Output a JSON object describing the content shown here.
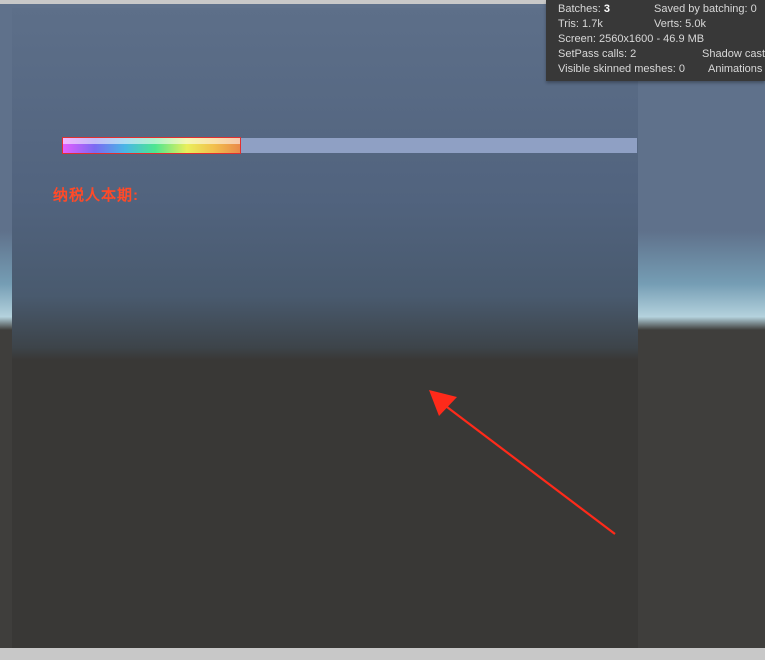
{
  "stats": {
    "batches_label": "Batches:",
    "batches_value": "3",
    "saved_label": "Saved by batching: 0",
    "tris_label": "Tris: 1.7k",
    "verts_label": "Verts: 5.0k",
    "screen_label": "Screen: 2560x1600 - 46.9 MB",
    "setpass_label": "SetPass calls: 2",
    "shadow_label": "Shadow cast",
    "meshes_label": "Visible skinned meshes: 0",
    "anim_label": "Animations"
  },
  "label_text": "纳税人本期:",
  "progress": {
    "percent": 31
  },
  "annotation": {
    "arrow_color": "#ff2a1a"
  }
}
